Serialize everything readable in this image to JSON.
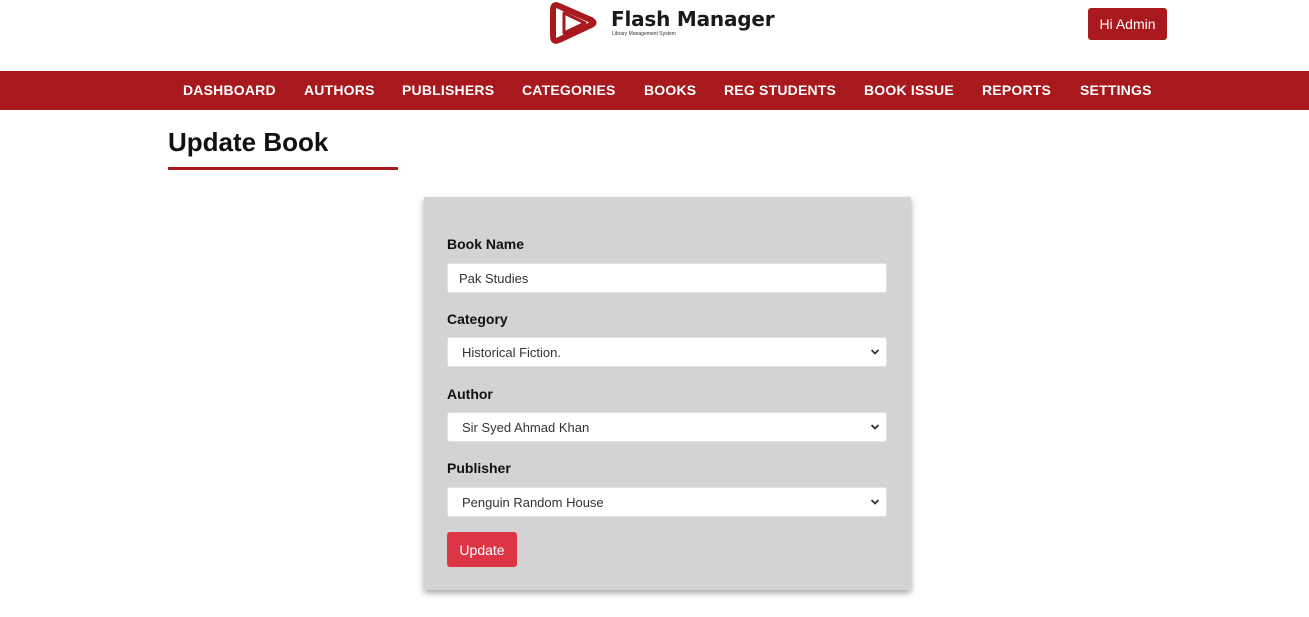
{
  "brand": {
    "title": "Flash Manager",
    "subtitle": "Library Management System",
    "accent_color": "#a8191e",
    "logo_icon": "play-triangle-logo"
  },
  "header": {
    "user_button": "Hi Admin"
  },
  "nav": {
    "items": [
      {
        "label": "DASHBOARD"
      },
      {
        "label": "AUTHORS"
      },
      {
        "label": "PUBLISHERS"
      },
      {
        "label": "CATEGORIES"
      },
      {
        "label": "BOOKS"
      },
      {
        "label": "REG STUDENTS"
      },
      {
        "label": "BOOK ISSUE"
      },
      {
        "label": "REPORTS"
      },
      {
        "label": "SETTINGS"
      }
    ]
  },
  "page": {
    "title": "Update Book"
  },
  "form": {
    "book_name": {
      "label": "Book Name",
      "value": "Pak Studies"
    },
    "category": {
      "label": "Category",
      "value": "Historical Fiction."
    },
    "author": {
      "label": "Author",
      "value": "Sir Syed Ahmad Khan"
    },
    "publisher": {
      "label": "Publisher",
      "value": "Penguin Random House"
    },
    "submit_label": "Update",
    "submit_color": "#dc3545"
  }
}
